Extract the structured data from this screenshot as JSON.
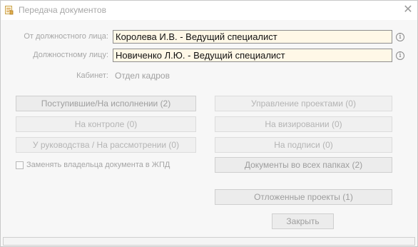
{
  "window": {
    "title": "Передача документов"
  },
  "from": {
    "label": "От должностного лица:",
    "value": "Королева И.В. - Ведущий специалист"
  },
  "to": {
    "label": "Должностному лицу:",
    "value": "Новиченко Л.Ю. - Ведущий специалист"
  },
  "office": {
    "label": "Кабинет:",
    "value": "Отдел кадров"
  },
  "buttons": {
    "incoming": "Поступившие/На исполнении (2)",
    "control": "На контроле (0)",
    "management": "У руководства / На рассмотрении  (0)",
    "projects": "Управление проектами (0)",
    "approval": "На визировании (0)",
    "signing": "На подписи (0)",
    "all_folders": "Документы во всех папках (2)",
    "deferred": "Отложенные проекты (1)",
    "close": "Закрыть"
  },
  "checkbox": {
    "label": "Заменять владельца документа в ЖПД",
    "checked": false
  },
  "icons": {
    "app": "document-icon",
    "close": "close-icon",
    "info": "info-icon"
  }
}
